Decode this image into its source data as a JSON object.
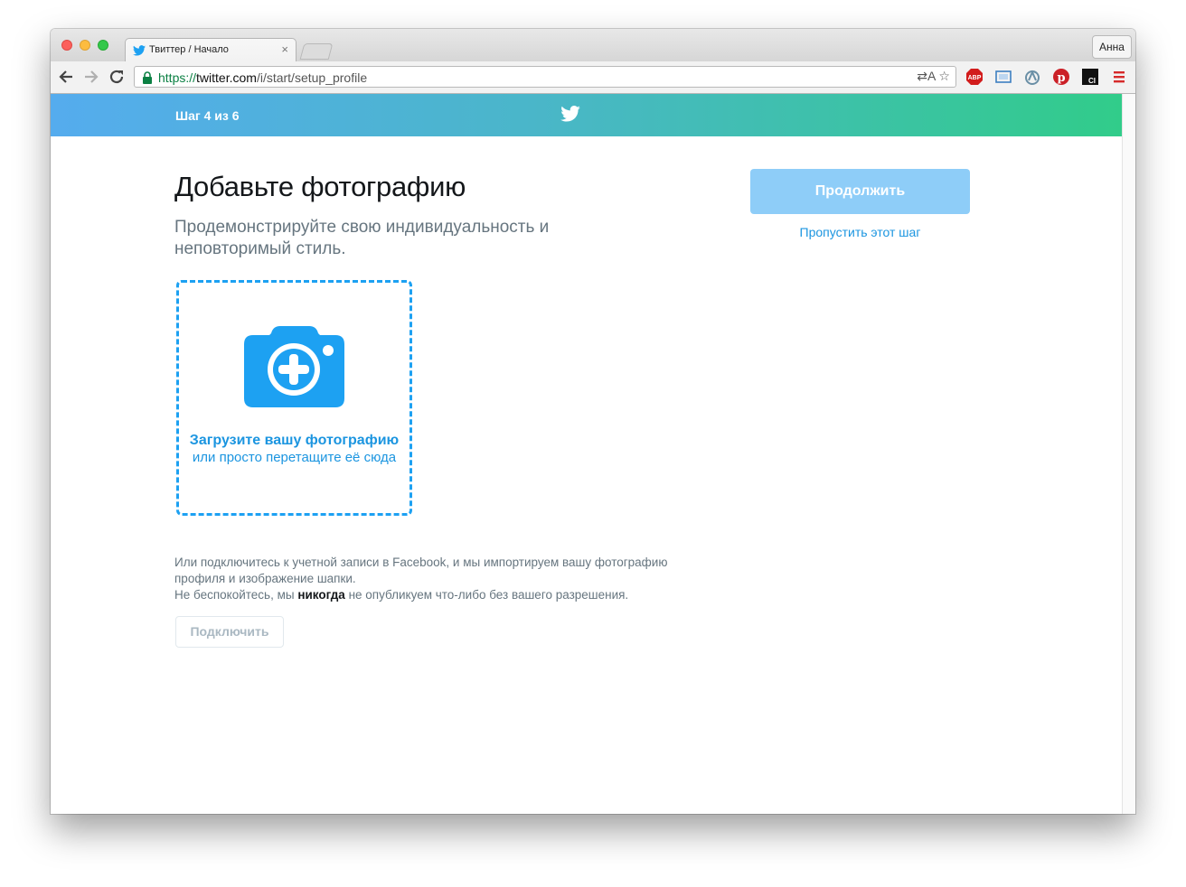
{
  "browser": {
    "tab": {
      "title": "Твиттер / Начало",
      "close": "×"
    },
    "profile": "Анна",
    "url": {
      "scheme": "https://",
      "host": "twitter.com",
      "path": "/i/start/setup_profile"
    },
    "omnibox_icons": "⇄A ☆",
    "extensions": [
      "adblock-plus-icon",
      "screen-capture-icon",
      "arc-icon",
      "pinterest-icon",
      "ci-icon",
      "chrome-menu-icon"
    ]
  },
  "header": {
    "step": "Шаг 4 из 6"
  },
  "main": {
    "title": "Добавьте фотографию",
    "subtitle": "Продемонстрируйте свою индивидуальность и неповторимый стиль.",
    "upload": {
      "main": "Загрузите вашу фотографию",
      "sub": "или просто перетащите её сюда"
    },
    "facebook": {
      "line1": "Или подключитесь к учетной записи в Facebook, и мы импортируем вашу фотографию профиля и изображение шапки.",
      "line2_pre": "Не беспокойтесь, мы ",
      "line2_bold": "никогда",
      "line2_post": " не опубликуем что-либо без вашего разрешения.",
      "connect": "Подключить"
    }
  },
  "sidebar": {
    "continue": "Продолжить",
    "skip": "Пропустить этот шаг"
  },
  "colors": {
    "accent": "#1da1f2",
    "banner_start": "#55acee",
    "banner_end": "#31cc8a",
    "continue_bg": "#8ecdf8"
  }
}
